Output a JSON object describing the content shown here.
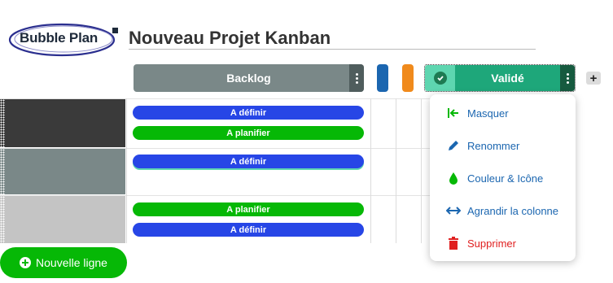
{
  "logo": {
    "text": "Bubble Plan"
  },
  "project": {
    "title": "Nouveau Projet Kanban"
  },
  "columns": {
    "backlog": {
      "label": "Backlog"
    },
    "valide": {
      "label": "Validé"
    },
    "add_label": "+"
  },
  "rows": [
    {
      "cards": [
        {
          "label": "A définir",
          "color": "#2746e6"
        },
        {
          "label": "A planifier",
          "color": "#06b806"
        }
      ]
    },
    {
      "cards": [
        {
          "label": "A définir",
          "color": "#2746e6"
        }
      ]
    },
    {
      "cards": [
        {
          "label": "A planifier",
          "color": "#06b806"
        },
        {
          "label": "A définir",
          "color": "#2746e6"
        }
      ]
    }
  ],
  "new_row_label": "Nouvelle ligne",
  "menu": {
    "items": [
      {
        "label": "Masquer",
        "icon": "hide-arrow-icon"
      },
      {
        "label": "Renommer",
        "icon": "pencil-icon"
      },
      {
        "label": "Couleur & Icône",
        "icon": "drop-icon"
      },
      {
        "label": "Agrandir la colonne",
        "icon": "expand-horizontal-icon"
      },
      {
        "label": "Supprimer",
        "icon": "trash-icon"
      }
    ]
  },
  "colors": {
    "backlog": "#7a8888",
    "valide": "#1ea77a",
    "column_blue": "#1b66b0",
    "column_orange": "#f08a1c",
    "green": "#06b806",
    "blue": "#2746e6",
    "danger": "#e02020"
  }
}
